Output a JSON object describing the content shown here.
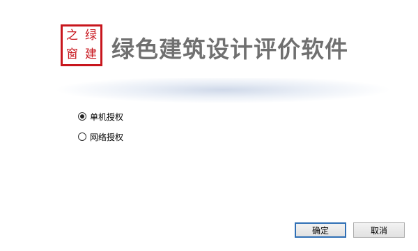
{
  "logo": {
    "seal_chars": [
      "之",
      "绿",
      "窗",
      "建"
    ],
    "seal_color": "#c8161d"
  },
  "header": {
    "title": "绿色建筑设计评价软件",
    "title_color": "#707070"
  },
  "license_options": [
    {
      "label": "单机授权",
      "checked": true
    },
    {
      "label": "网络授权",
      "checked": false
    }
  ],
  "buttons": {
    "ok_label": "确定",
    "cancel_label": "取消"
  },
  "colors": {
    "accent_focus": "#2f6fb5"
  }
}
